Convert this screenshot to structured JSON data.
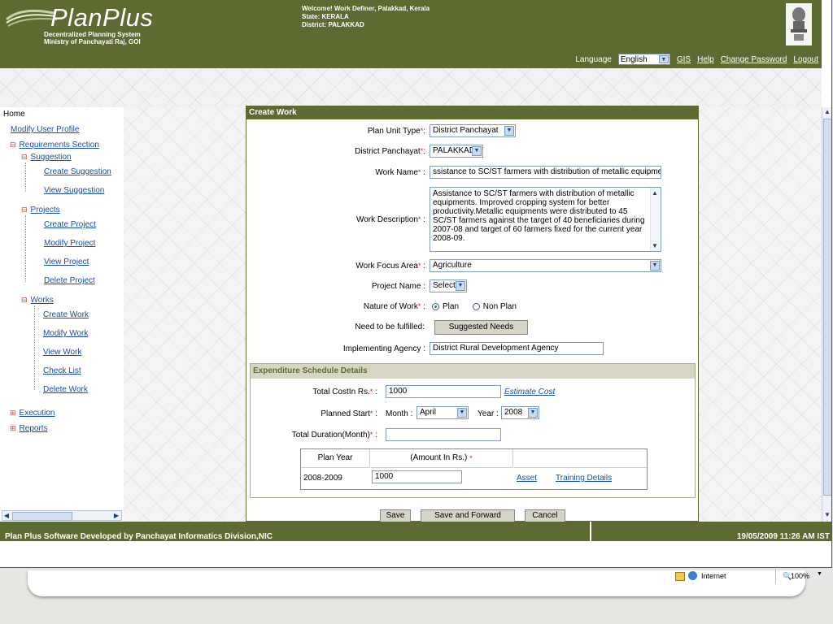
{
  "header": {
    "logo_title": "PlanPlus",
    "logo_sub_1": "Decentralized Planning System",
    "logo_sub_2": "Ministry of Panchayati Raj, GOI",
    "welcome": "Welcome!  Work Definer, Palakkad, Kerala",
    "state": "State: KERALA",
    "district": "District: PALAKKAD",
    "language_label": "Language",
    "language_value": "English",
    "links": {
      "gis": "GIS",
      "help": "Help",
      "change_password": "Change Password",
      "logout": "Logout"
    }
  },
  "sidebar": {
    "home": "Home",
    "modify_profile": "Modify User Profile",
    "requirements": "Requirements Section",
    "suggestion": "Suggestion",
    "create_suggestion": "Create Suggestion",
    "view_suggestion": "View Suggestion",
    "projects": "Projects",
    "create_project": "Create Project",
    "modify_project": "Modify Project",
    "view_project": "View Project",
    "delete_project": "Delete Project",
    "works": "Works",
    "create_work": "Create Work",
    "modify_work": "Modify Work",
    "view_work": "View Work",
    "check_list": "Check List",
    "delete_work": "Delete Work",
    "execution": "Execution",
    "reports": "Reports"
  },
  "form": {
    "title": "Create Work",
    "plan_unit_type_label": "Plan Unit Type",
    "plan_unit_type_value": "District Panchayat",
    "district_panchayat_label": "District Panchayat",
    "district_panchayat_value": "PALAKKAD",
    "work_name_label": "Work Name",
    "work_name_value": "ssistance to SC/ST farmers with distribution of metallic equipments",
    "work_description_label": "Work Description",
    "work_description_value": "Assistance to SC/ST farmers with distribution of metallic equipments.    Improved cropping system for better productivity.Metallic equipments were distributed to 45 SC/ST farmers against the target of 40 beneficiaries during 2007-08 and target of 60 farmers fixed for the current year 2008-09.",
    "work_focus_area_label": "Work Focus Area",
    "work_focus_area_value": "Agriculture",
    "project_name_label": "Project Name :",
    "project_name_value": "Select",
    "nature_of_work_label": "Nature of Work",
    "nature_plan": "Plan",
    "nature_non_plan": "Non Plan",
    "need_label": "Need to be fulfilled:",
    "suggested_needs_button": "Suggested Needs",
    "implementing_agency_label": "Implementing Agency :",
    "implementing_agency_value": "District Rural Development Agency"
  },
  "expenditure": {
    "title": "Expenditure Schedule Details",
    "total_cost_label": "Total CostIn Rs.",
    "total_cost_value": "1000",
    "estimate_cost_link": "Estimate Cost",
    "planned_start_label": "Planned Start",
    "month_label": "Month :",
    "month_value": "April",
    "year_label": "Year :",
    "year_value": "2008",
    "total_duration_label": "Total Duration(Month)",
    "total_duration_value": "",
    "table_headers": [
      "Plan Year",
      "(Amount In Rs.)"
    ],
    "rows": [
      {
        "year": "2008-2009",
        "amount": "1000",
        "asset": "Asset",
        "training": "Training Details"
      }
    ]
  },
  "buttons": {
    "save": "Save",
    "save_forward": "Save and Forward",
    "cancel": "Cancel"
  },
  "footer": {
    "left": "Plan Plus Software Developed by Panchayat Informatics Division,NIC",
    "right": "19/05/2009 11:26 AM IST"
  },
  "statusbar": {
    "zone": "Internet",
    "zoom": "100%"
  },
  "colors": {
    "header_green": "#5b6b32",
    "link_blue": "#1a4d9e",
    "required_red": "#d21f1f",
    "subheader_tan": "#d7d6c2"
  }
}
